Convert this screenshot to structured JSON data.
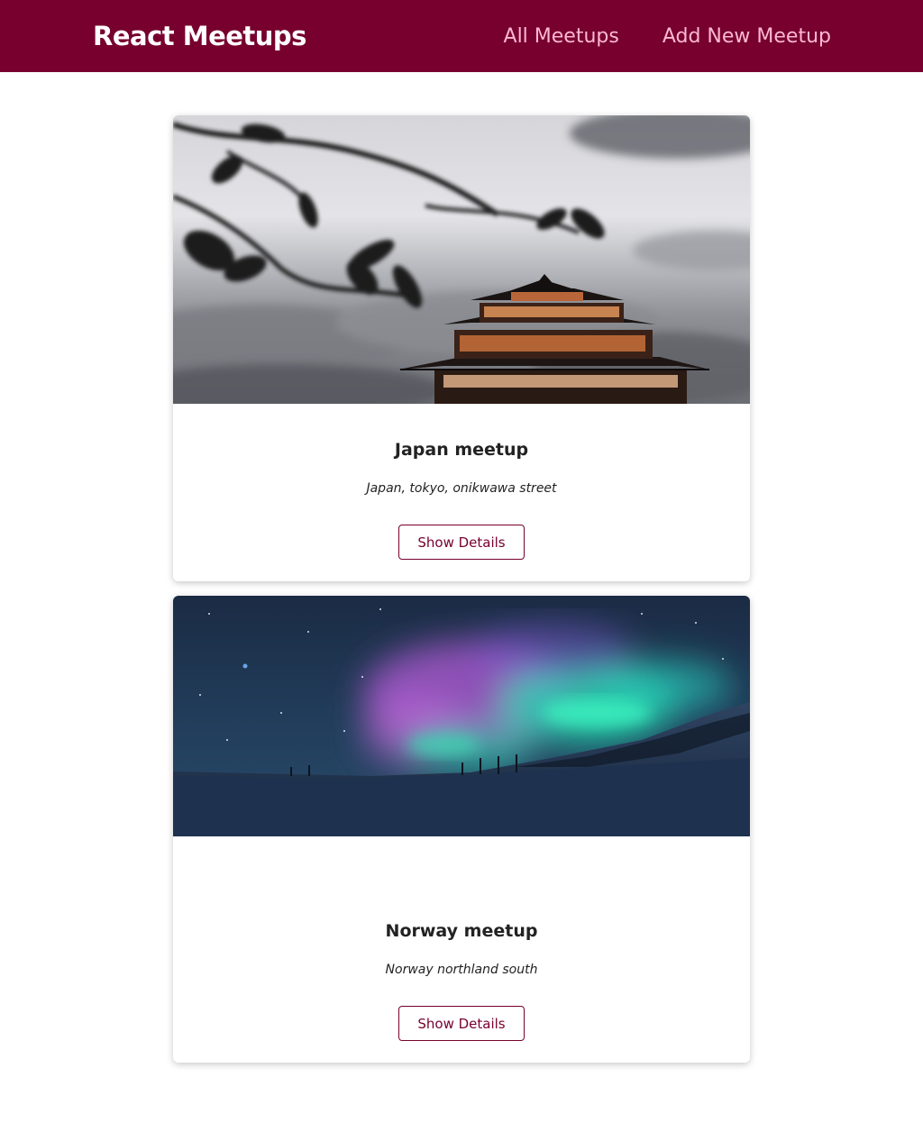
{
  "header": {
    "logo": "React Meetups",
    "nav": [
      {
        "label": "All Meetups"
      },
      {
        "label": "Add New Meetup"
      }
    ]
  },
  "meetups": [
    {
      "title": "Japan meetup",
      "address": "Japan, tokyo, onikwawa street",
      "image_subject": "japanese-castle-photo",
      "button_label": "Show Details"
    },
    {
      "title": "Norway meetup",
      "address": "Norway northland south",
      "image_subject": "northern-lights-photo",
      "button_label": "Show Details"
    }
  ],
  "colors": {
    "brand": "#77002e",
    "nav_link": "#fcb8d2",
    "logo": "#ffffff"
  }
}
